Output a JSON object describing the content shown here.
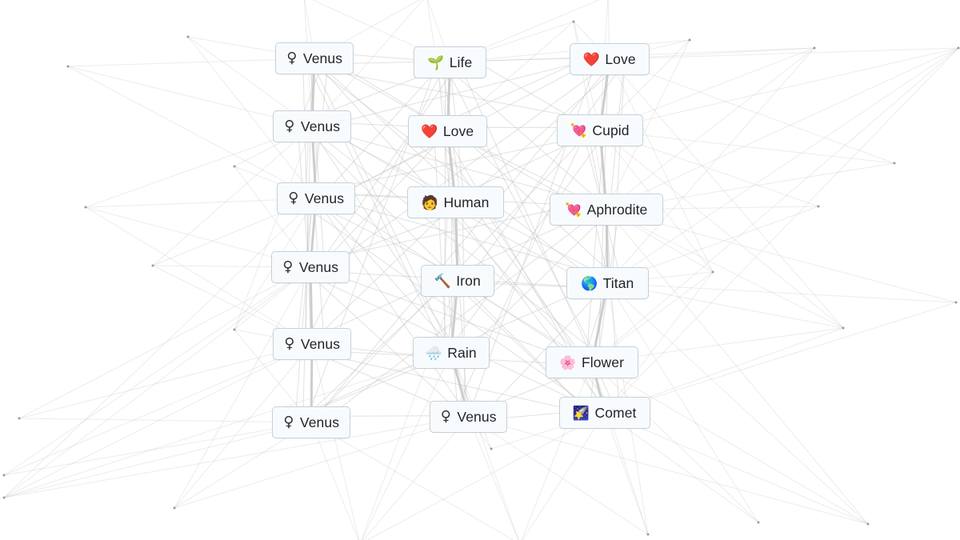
{
  "canvas": {
    "background": "#ffffff",
    "edge_color": "#c8c8c8",
    "node_dot_color": "#9a9a9a"
  },
  "tiles": [
    {
      "id": "venus-1",
      "label": "Venus",
      "icon": "venus-symbol-icon",
      "glyph": "♀"
    },
    {
      "id": "life",
      "label": "Life",
      "icon": "seedling-icon",
      "glyph": "🌱"
    },
    {
      "id": "love-1",
      "label": "Love",
      "icon": "red-heart-icon",
      "glyph": "❤️"
    },
    {
      "id": "venus-2",
      "label": "Venus",
      "icon": "venus-symbol-icon",
      "glyph": "♀"
    },
    {
      "id": "love-2",
      "label": "Love",
      "icon": "red-heart-icon",
      "glyph": "❤️"
    },
    {
      "id": "cupid",
      "label": "Cupid",
      "icon": "heart-with-arrow-icon",
      "glyph": "💘"
    },
    {
      "id": "venus-3",
      "label": "Venus",
      "icon": "venus-symbol-icon",
      "glyph": "♀"
    },
    {
      "id": "human",
      "label": "Human",
      "icon": "person-face-icon",
      "glyph": "🧑"
    },
    {
      "id": "aphrodite",
      "label": "Aphrodite",
      "icon": "heart-with-arrow-icon",
      "glyph": "💘"
    },
    {
      "id": "venus-4",
      "label": "Venus",
      "icon": "venus-symbol-icon",
      "glyph": "♀"
    },
    {
      "id": "iron",
      "label": "Iron",
      "icon": "hammer-icon",
      "glyph": "🔨"
    },
    {
      "id": "titan",
      "label": "Titan",
      "icon": "globe-icon",
      "glyph": "🌎"
    },
    {
      "id": "venus-5",
      "label": "Venus",
      "icon": "venus-symbol-icon",
      "glyph": "♀"
    },
    {
      "id": "rain",
      "label": "Rain",
      "icon": "cloud-rain-icon",
      "glyph": "🌧️"
    },
    {
      "id": "flower",
      "label": "Flower",
      "icon": "cherry-blossom-icon",
      "glyph": "🌸"
    },
    {
      "id": "venus-6",
      "label": "Venus",
      "icon": "venus-symbol-icon",
      "glyph": "♀"
    },
    {
      "id": "venus-7",
      "label": "Venus",
      "icon": "venus-symbol-icon",
      "glyph": "♀"
    },
    {
      "id": "comet",
      "label": "Comet",
      "icon": "comet-icon",
      "glyph": "🌠"
    }
  ]
}
